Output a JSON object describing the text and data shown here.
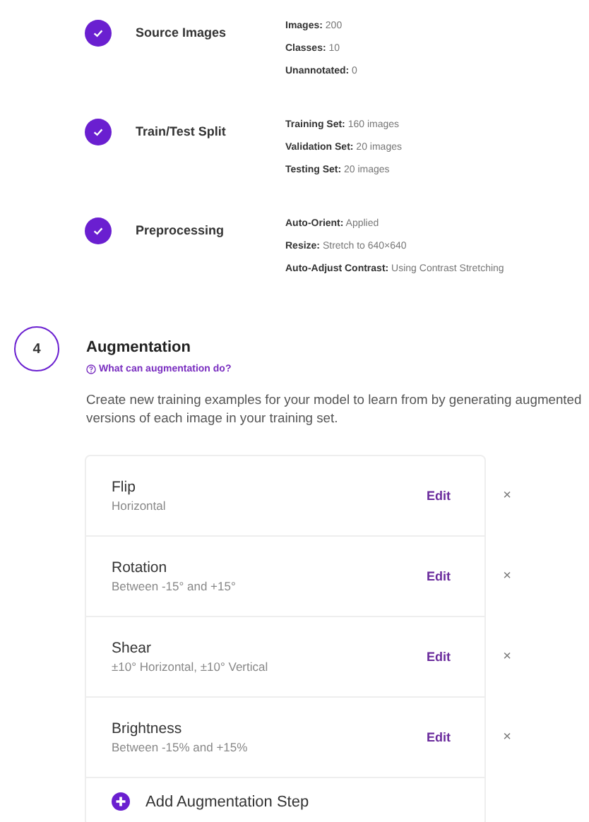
{
  "completed_steps": [
    {
      "title": "Source Images",
      "completed": true,
      "details": [
        "**Images:** 200",
        "**Classes:** 10",
        "**Unannotated:** 0"
      ]
    },
    {
      "title": "Train/Test Split",
      "completed": true,
      "details": [
        "**Training Set:** 160 images",
        "**Validation Set:** 20 images",
        "**Testing Set:** 20 images"
      ]
    },
    {
      "title": "Preprocessing",
      "completed": true,
      "details": [
        "**Auto-Orient:** Applied",
        "**Resize:** Stretch to 640×640",
        "**Auto-Adjust Contrast:** Using Contrast Stretching"
      ]
    }
  ],
  "current_step": {
    "number": "4",
    "title": "Augmentation",
    "help_link": "What can augmentation do?",
    "description": "Create new training examples for your model to learn from by generating augmented versions of each image in your training set.",
    "augmentations": [
      {
        "name": "Flip",
        "setting": "Horizontal",
        "edit": "Edit",
        "remove": "×"
      },
      {
        "name": "Rotation",
        "setting": "Between -15° and +15°",
        "edit": "Edit",
        "remove": "×"
      },
      {
        "name": "Shear",
        "setting": "±10° Horizontal, ±10° Vertical",
        "edit": "Edit",
        "remove": "×"
      },
      {
        "name": "Brightness",
        "setting": "Between -15% and +15%",
        "edit": "Edit",
        "remove": "×"
      }
    ],
    "add_button": "Add Augmentation Step"
  }
}
